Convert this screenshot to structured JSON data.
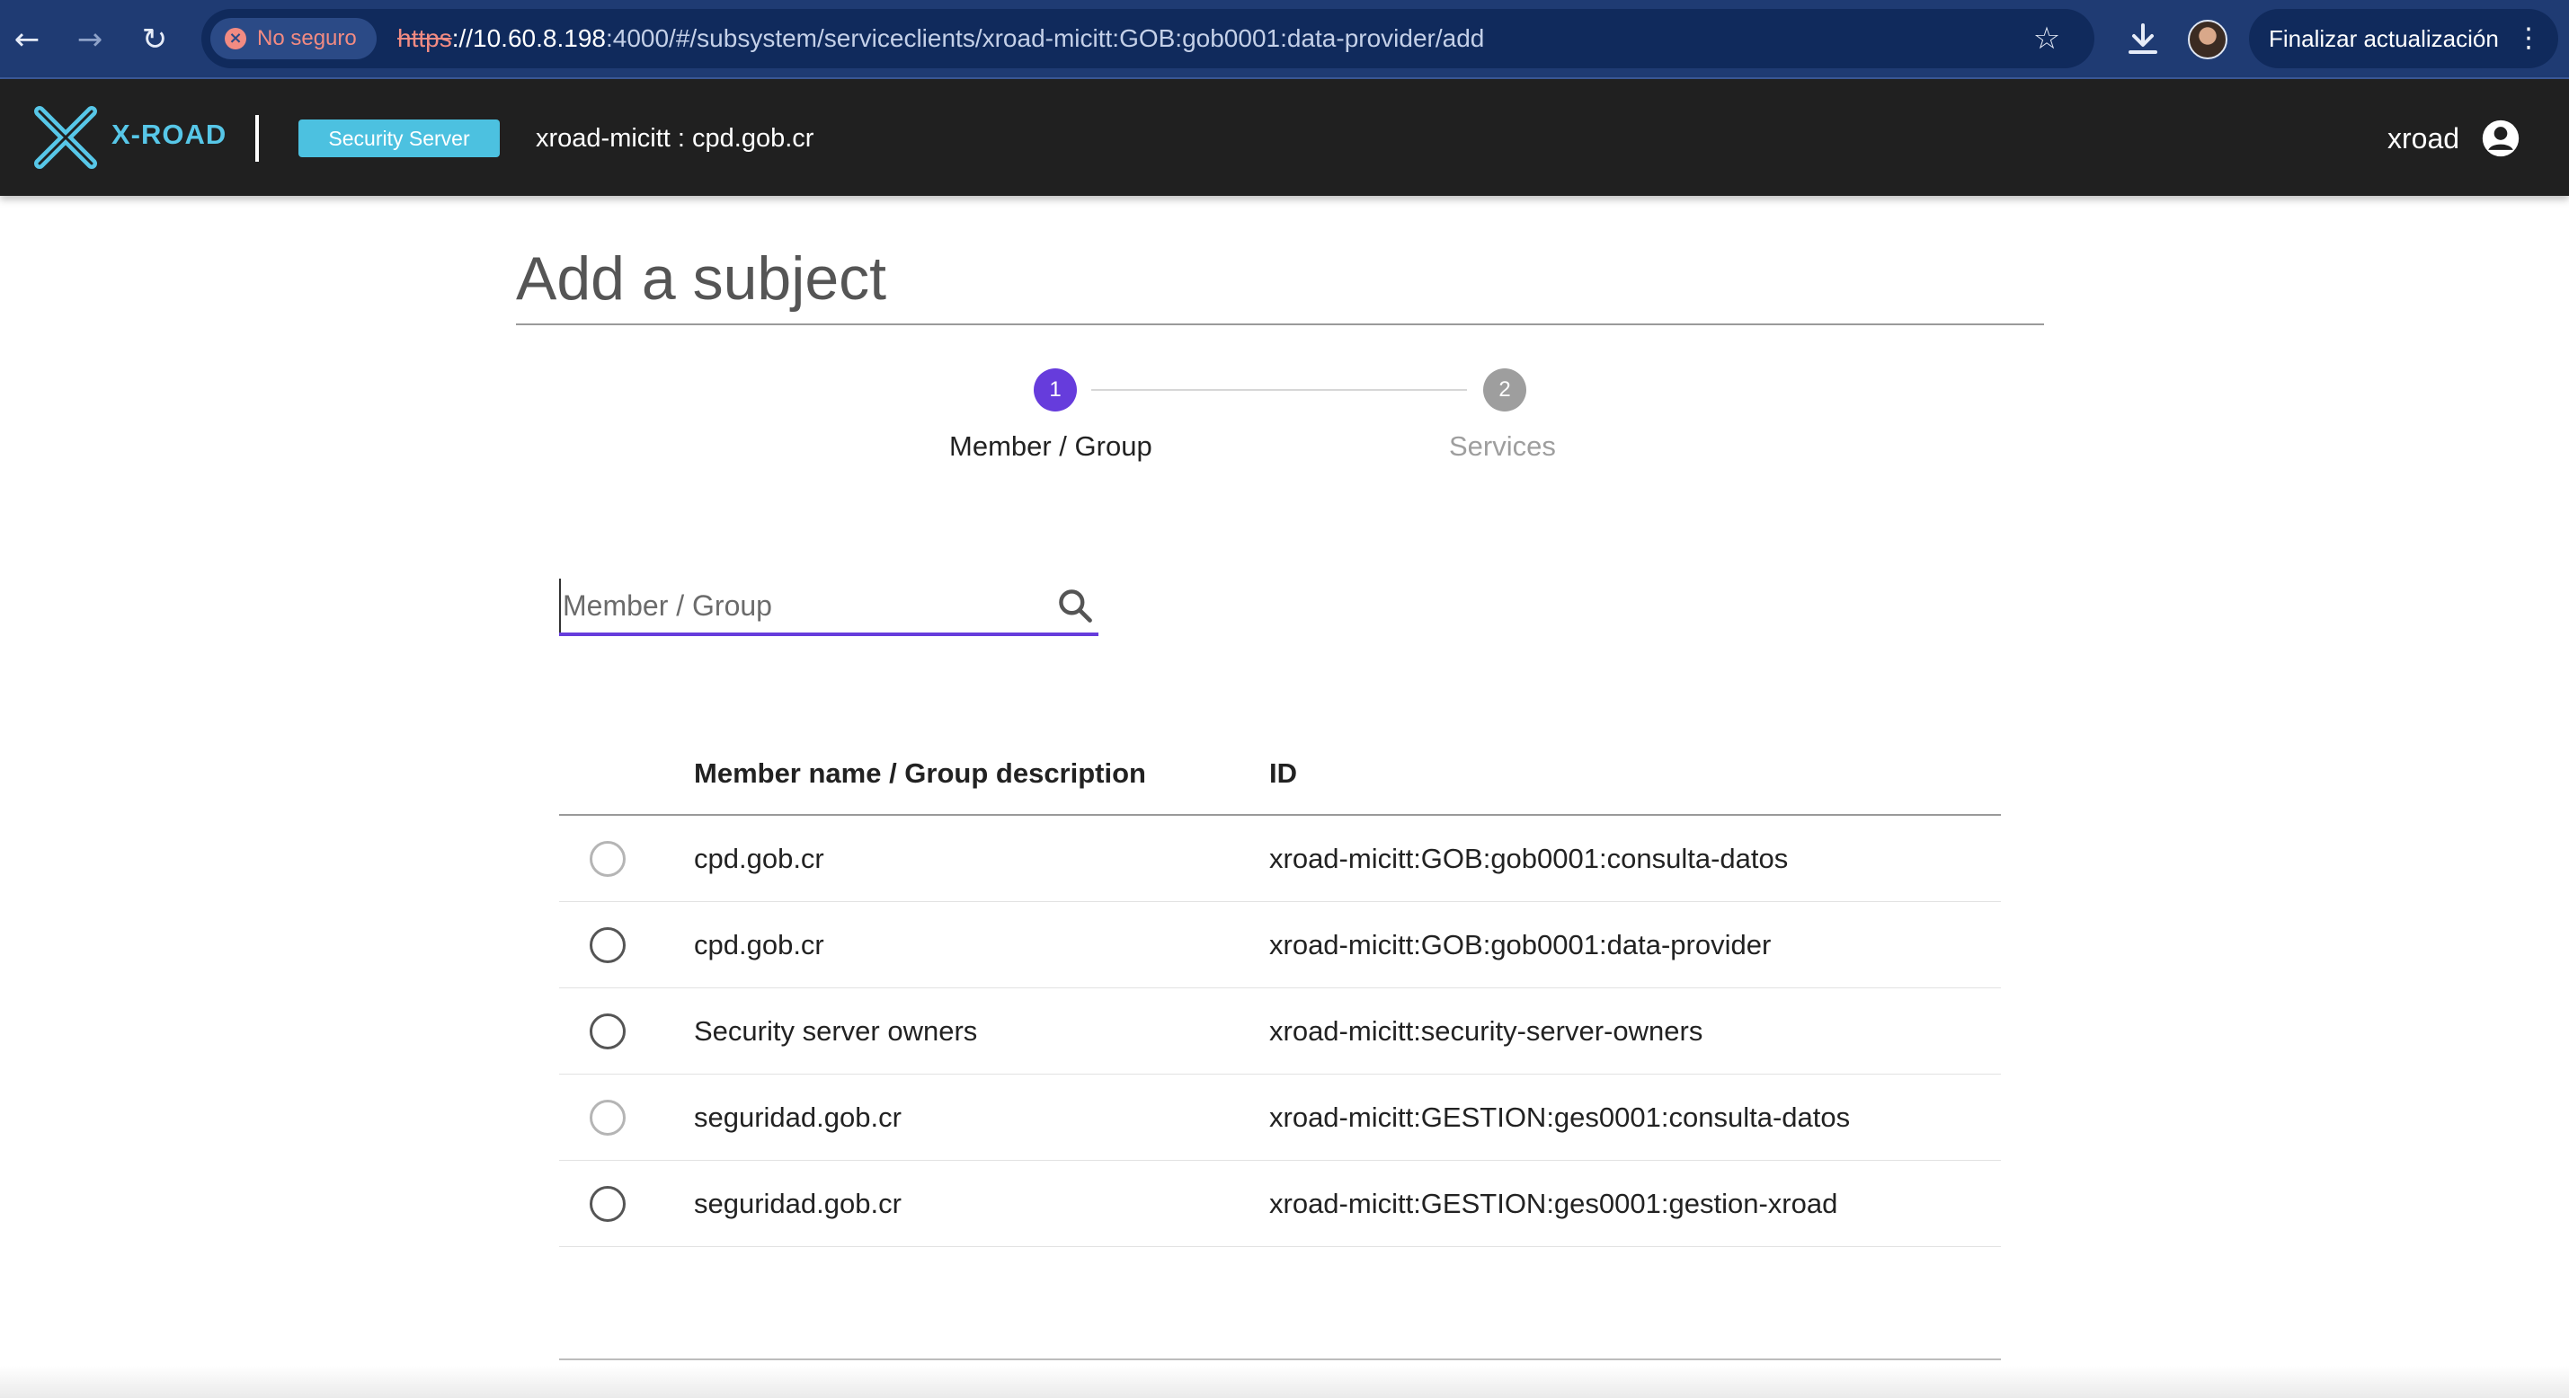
{
  "browser": {
    "security_label": "No seguro",
    "url_scheme": "https",
    "url_host": "://10.60.8.198",
    "url_rest": ":4000/#/subsystem/serviceclients/xroad-micitt:GOB:gob0001:data-provider/add",
    "update_button": "Finalizar actualización",
    "icons": [
      "back-arrow-icon",
      "forward-arrow-icon",
      "reload-icon",
      "star-icon",
      "download-icon",
      "profile-avatar",
      "menu-dots-icon"
    ]
  },
  "header": {
    "logo_text": "X-ROAD",
    "badge": "Security Server",
    "server_id": "xroad-micitt : cpd.gob.cr",
    "user": "xroad",
    "accent": "#57c7e8"
  },
  "page": {
    "title": "Add a subject"
  },
  "stepper": {
    "steps": [
      {
        "number": "1",
        "label": "Member / Group",
        "active": true
      },
      {
        "number": "2",
        "label": "Services",
        "active": false
      }
    ],
    "active_color": "#663cdc"
  },
  "search": {
    "placeholder": "Member / Group",
    "value": ""
  },
  "table": {
    "headers": {
      "name": "Member name / Group description",
      "id": "ID"
    },
    "rows": [
      {
        "name": "cpd.gob.cr",
        "id": "xroad-micitt:GOB:gob0001:consulta-datos"
      },
      {
        "name": "cpd.gob.cr",
        "id": "xroad-micitt:GOB:gob0001:data-provider"
      },
      {
        "name": "Security server owners",
        "id": "xroad-micitt:security-server-owners"
      },
      {
        "name": "seguridad.gob.cr",
        "id": "xroad-micitt:GESTION:ges0001:consulta-datos"
      },
      {
        "name": "seguridad.gob.cr",
        "id": "xroad-micitt:GESTION:ges0001:gestion-xroad"
      }
    ]
  }
}
